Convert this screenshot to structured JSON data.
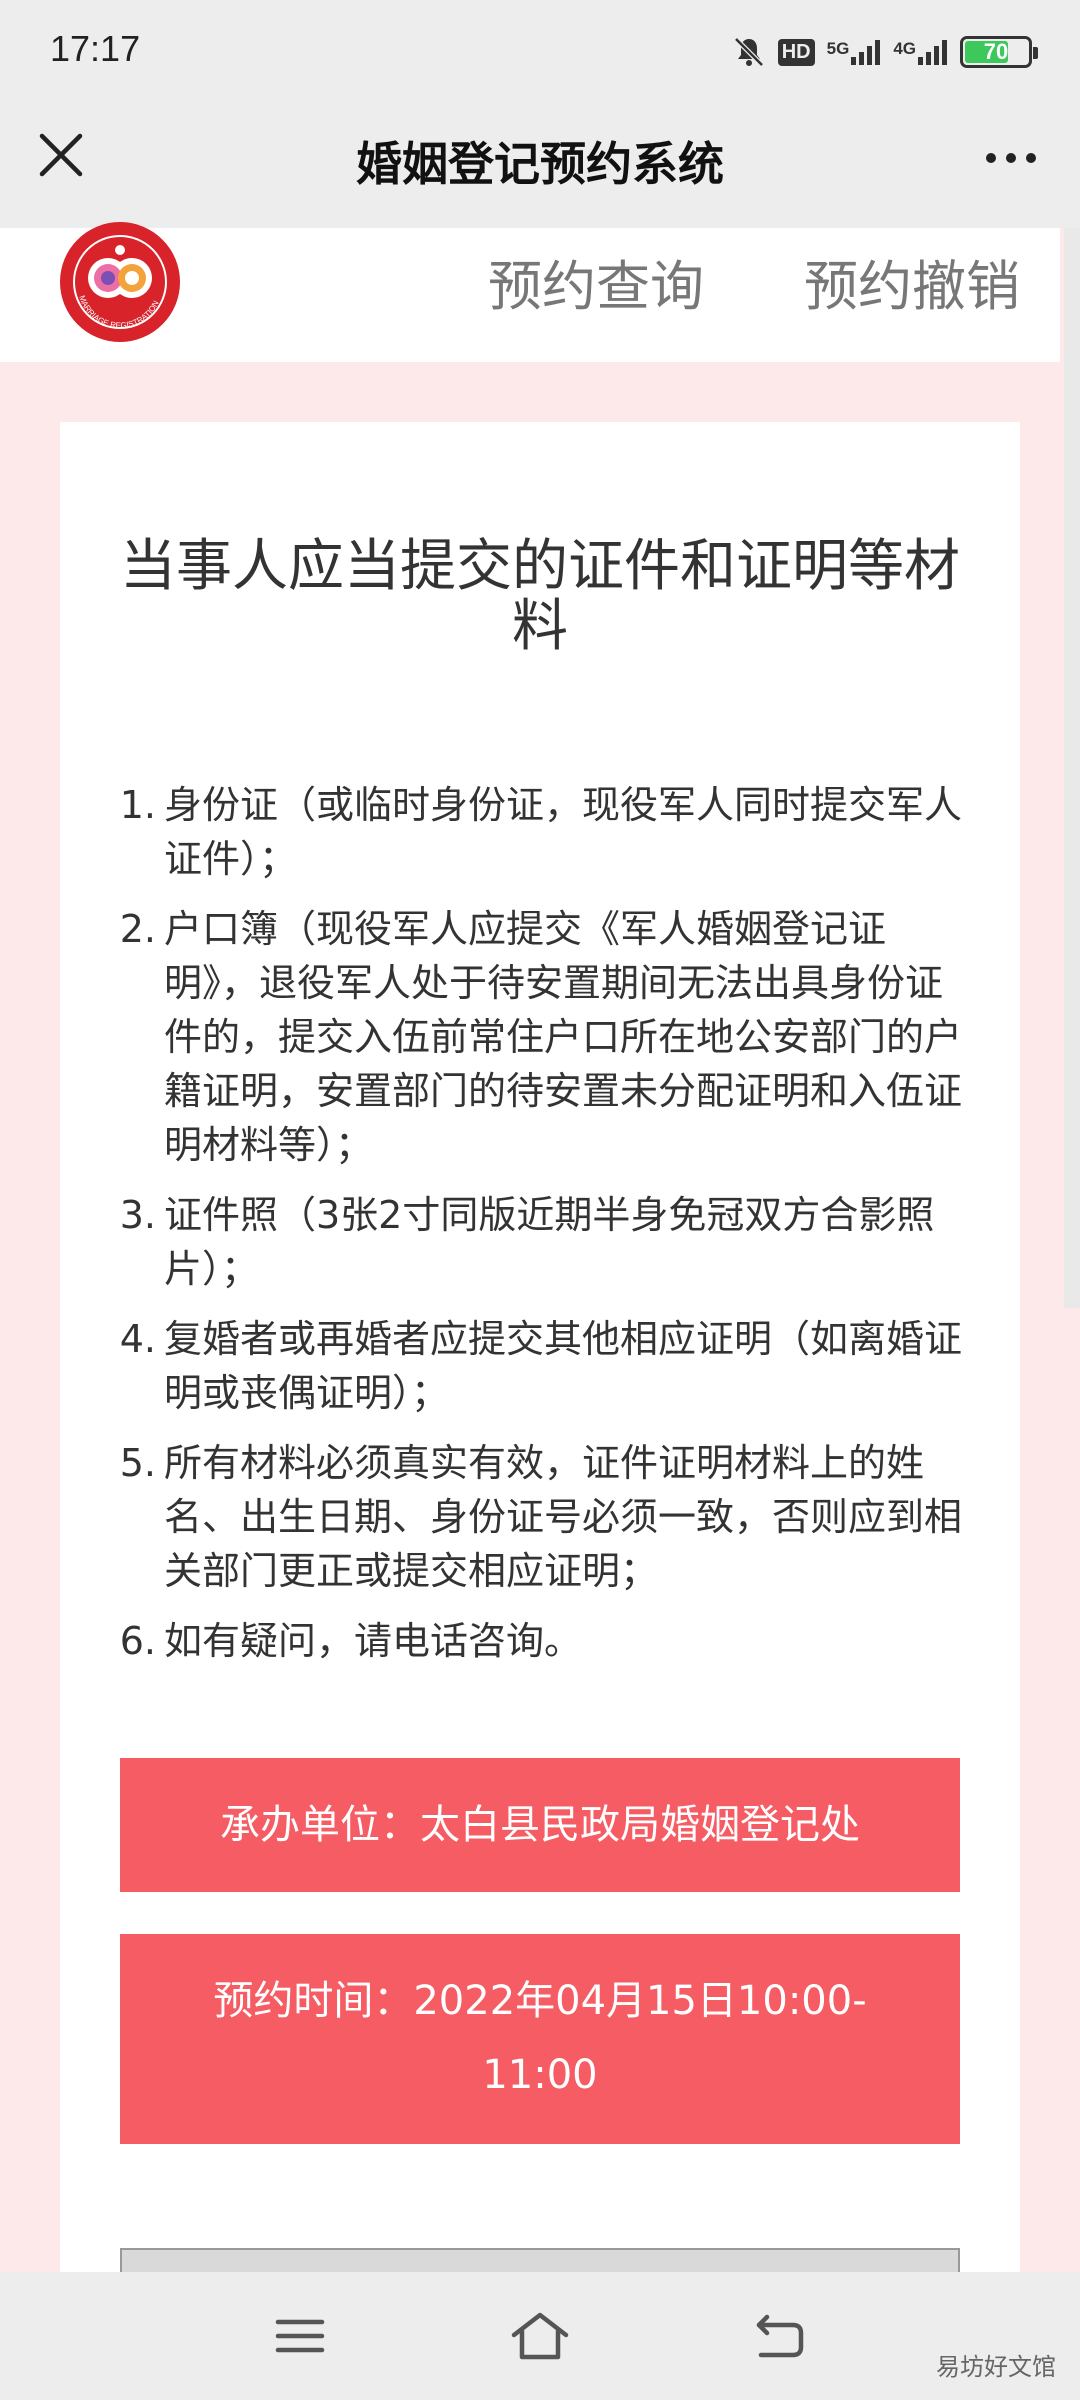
{
  "status_bar": {
    "time": "17:17",
    "network_1": "5G",
    "network_2": "4G",
    "hd_label": "HD",
    "battery": "70"
  },
  "nav_bar": {
    "title": "婚姻登记预约系统",
    "close_icon": "close-icon",
    "more_icon": "more-icon"
  },
  "header": {
    "logo_icon": "marriage-registration-logo",
    "logo_text": "MARRIAGE REGISTRATION",
    "links": [
      "预约查询",
      "预约撤销"
    ]
  },
  "content": {
    "title": "当事人应当提交的证件和证明等材料",
    "requirements": [
      {
        "num": "1.",
        "text": "身份证（或临时身份证，现役军人同时提交军人证件）；"
      },
      {
        "num": "2.",
        "text": "户口簿（现役军人应提交《军人婚姻登记证明》，退役军人处于待安置期间无法出具身份证件的，提交入伍前常住户口所在地公安部门的户籍证明，安置部门的待安置未分配证明和入伍证明材料等）；"
      },
      {
        "num": "3.",
        "text": "证件照（3张2寸同版近期半身免冠双方合影照片）；"
      },
      {
        "num": "4.",
        "text": "复婚者或再婚者应提交其他相应证明（如离婚证明或丧偶证明）；"
      },
      {
        "num": "5.",
        "text": "所有材料必须真实有效，证件证明材料上的姓名、出生日期、身份证号必须一致，否则应到相关部门更正或提交相应证明；"
      },
      {
        "num": "6.",
        "text": "如有疑问，请电话咨询。"
      }
    ],
    "organizer": "承办单位：太白县民政局婚姻登记处",
    "appointment_time": "预约时间：2022年04月15日10:00-11:00"
  },
  "bottom_nav": {
    "icons": [
      "menu-icon",
      "home-icon",
      "back-icon"
    ]
  },
  "watermark": "易坊好文馆",
  "colors": {
    "accent": "#f65c64",
    "page_bg": "#fde8ea",
    "bar_bg": "#ededed"
  }
}
